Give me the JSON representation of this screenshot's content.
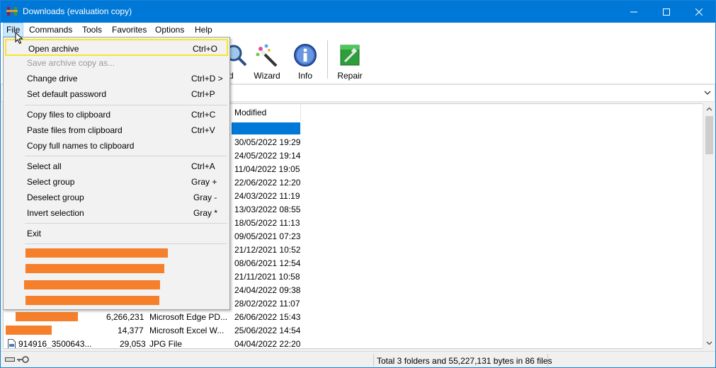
{
  "window": {
    "title": "Downloads (evaluation copy)"
  },
  "menubar": {
    "items": [
      "File",
      "Commands",
      "Tools",
      "Favorites",
      "Options",
      "Help"
    ]
  },
  "toolbar": {
    "partial_label": "d",
    "buttons": [
      {
        "label": "Wizard",
        "icon": "wizard-icon"
      },
      {
        "label": "Info",
        "icon": "info-icon"
      },
      {
        "label": "Repair",
        "icon": "repair-icon"
      }
    ]
  },
  "filelist": {
    "column_modified": "Modified",
    "modified_dates": [
      "30/05/2022 19:29",
      "24/05/2022 19:14",
      "11/04/2022 19:05",
      "22/06/2022 12:20",
      "24/03/2022 11:19",
      "13/03/2022 08:55",
      "18/05/2022 11:13",
      "09/05/2021 07:23",
      "21/12/2021 10:52",
      "08/06/2021 12:54",
      "21/11/2021 10:58",
      "24/04/2022 09:38",
      "28/02/2022 11:07"
    ],
    "visible_rows": [
      {
        "name": "",
        "size": "6,266,231",
        "type": "Microsoft Edge PD...",
        "modified": "26/06/2022 15:43"
      },
      {
        "name": "",
        "size": "14,377",
        "type": "Microsoft Excel W...",
        "modified": "25/06/2022 14:54"
      },
      {
        "name": "914916_3500643...",
        "size": "29,053",
        "type": "JPG File",
        "modified": "04/04/2022 22:20"
      }
    ]
  },
  "status": {
    "summary": "Total 3 folders and 55,227,131 bytes in 86 files"
  },
  "file_menu": {
    "items": [
      {
        "label": "Open archive",
        "shortcut": "Ctrl+O",
        "enabled": true,
        "highlighted": true
      },
      {
        "label": "Save archive copy as...",
        "shortcut": "",
        "enabled": false
      },
      {
        "label": "Change drive",
        "shortcut": "Ctrl+D >",
        "enabled": true
      },
      {
        "label": "Set default password",
        "shortcut": "Ctrl+P",
        "enabled": true
      },
      {
        "label": "Copy files to clipboard",
        "shortcut": "Ctrl+C",
        "enabled": true
      },
      {
        "label": "Paste files from clipboard",
        "shortcut": "Ctrl+V",
        "enabled": true
      },
      {
        "label": "Copy full names to clipboard",
        "shortcut": "",
        "enabled": true
      },
      {
        "label": "Select all",
        "shortcut": "Ctrl+A",
        "enabled": true
      },
      {
        "label": "Select group",
        "shortcut": "Gray +",
        "enabled": true
      },
      {
        "label": "Deselect group",
        "shortcut": "Gray -",
        "enabled": true
      },
      {
        "label": "Invert selection",
        "shortcut": "Gray *",
        "enabled": true
      },
      {
        "label": "Exit",
        "shortcut": "",
        "enabled": true
      }
    ]
  },
  "colors": {
    "titlebar": "#0078d7",
    "selection": "#0078d7",
    "highlight_outline": "#f5e62a",
    "redaction": "#f57f2b"
  }
}
